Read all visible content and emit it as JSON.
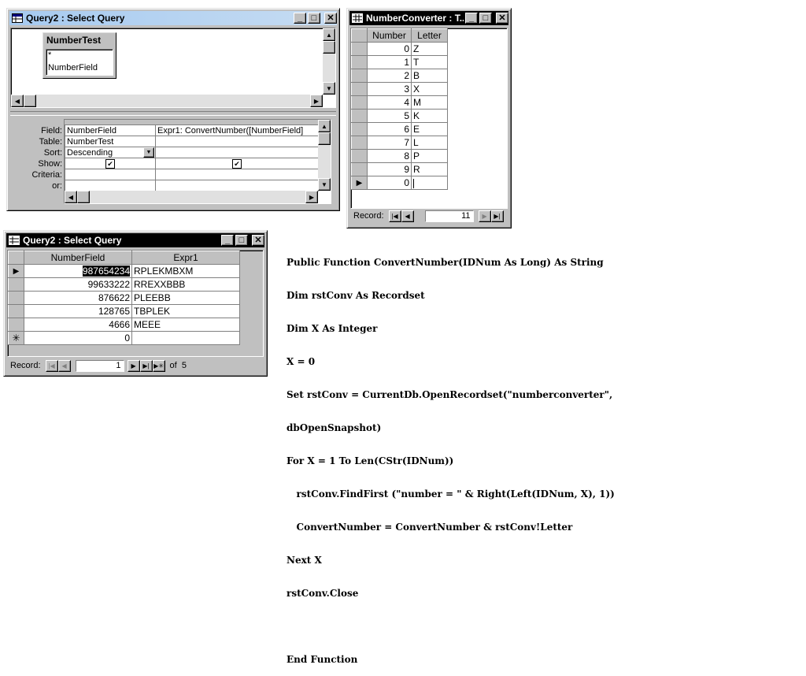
{
  "design_window": {
    "title": "Query2 : Select Query",
    "table_box": {
      "title": "NumberTest",
      "fields": [
        "*",
        "NumberField"
      ]
    },
    "grid_labels": {
      "field": "Field:",
      "table": "Table:",
      "sort": "Sort:",
      "show": "Show:",
      "criteria": "Criteria:",
      "or": "or:"
    },
    "columns": [
      {
        "field": "NumberField",
        "table": "NumberTest",
        "sort": "Descending",
        "show": true
      },
      {
        "field": "Expr1: ConvertNumber([NumberField]",
        "table": "",
        "sort": "",
        "show": true
      }
    ]
  },
  "converter_window": {
    "title": "NumberConverter : T...",
    "headers": [
      "Number",
      "Letter"
    ],
    "rows": [
      {
        "number": "0",
        "letter": "Z"
      },
      {
        "number": "1",
        "letter": "T"
      },
      {
        "number": "2",
        "letter": "B"
      },
      {
        "number": "3",
        "letter": "X"
      },
      {
        "number": "4",
        "letter": "M"
      },
      {
        "number": "5",
        "letter": "K"
      },
      {
        "number": "6",
        "letter": "E"
      },
      {
        "number": "7",
        "letter": "L"
      },
      {
        "number": "8",
        "letter": "P"
      },
      {
        "number": "9",
        "letter": "R"
      },
      {
        "number": "0",
        "letter": ""
      }
    ],
    "record_label": "Record:",
    "record_number": "11"
  },
  "results_window": {
    "title": "Query2 : Select Query",
    "headers": [
      "NumberField",
      "Expr1"
    ],
    "rows": [
      {
        "number": "987654234",
        "expr": "RPLEKMBXM"
      },
      {
        "number": "99633222",
        "expr": "RREXXBBB"
      },
      {
        "number": "876622",
        "expr": "PLEEBB"
      },
      {
        "number": "128765",
        "expr": "TBPLEK"
      },
      {
        "number": "4666",
        "expr": "MEEE"
      },
      {
        "number": "0",
        "expr": ""
      }
    ],
    "record_label": "Record:",
    "record_number": "1",
    "record_of": "of  5"
  },
  "code_lines": [
    "Public Function ConvertNumber(IDNum As Long) As String",
    "Dim rstConv As Recordset",
    "Dim X As Integer",
    "X = 0",
    "Set rstConv = CurrentDb.OpenRecordset(\"numberconverter\",",
    "dbOpenSnapshot)",
    "For X = 1 To Len(CStr(IDNum))",
    "   rstConv.FindFirst (\"number = \" & Right(Left(IDNum, X), 1))",
    "   ConvertNumber = ConvertNumber & rstConv!Letter",
    "Next X",
    "rstConv.Close",
    "",
    "End Function"
  ]
}
